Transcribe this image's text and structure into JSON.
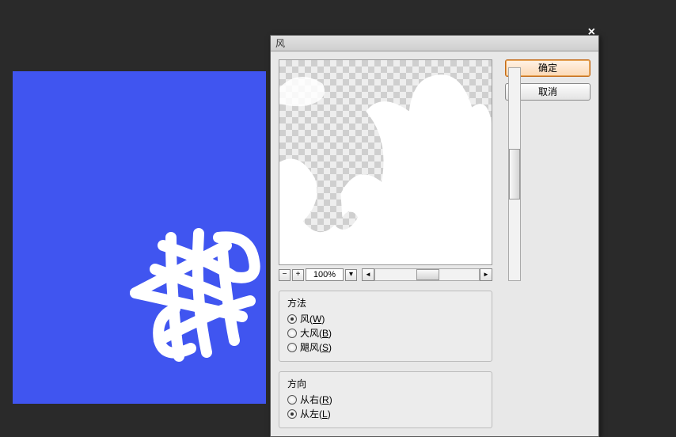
{
  "dialog": {
    "title": "风",
    "buttons": {
      "ok": "确定",
      "cancel": "取消"
    },
    "preview": {
      "zoom": "100%"
    },
    "method": {
      "label": "方法",
      "options": [
        {
          "label": "风",
          "accel": "W",
          "checked": true
        },
        {
          "label": "大风",
          "accel": "B",
          "checked": false
        },
        {
          "label": "飓风",
          "accel": "S",
          "checked": false
        }
      ]
    },
    "direction": {
      "label": "方向",
      "options": [
        {
          "label": "从右",
          "accel": "R",
          "checked": false
        },
        {
          "label": "从左",
          "accel": "L",
          "checked": true
        }
      ]
    }
  }
}
